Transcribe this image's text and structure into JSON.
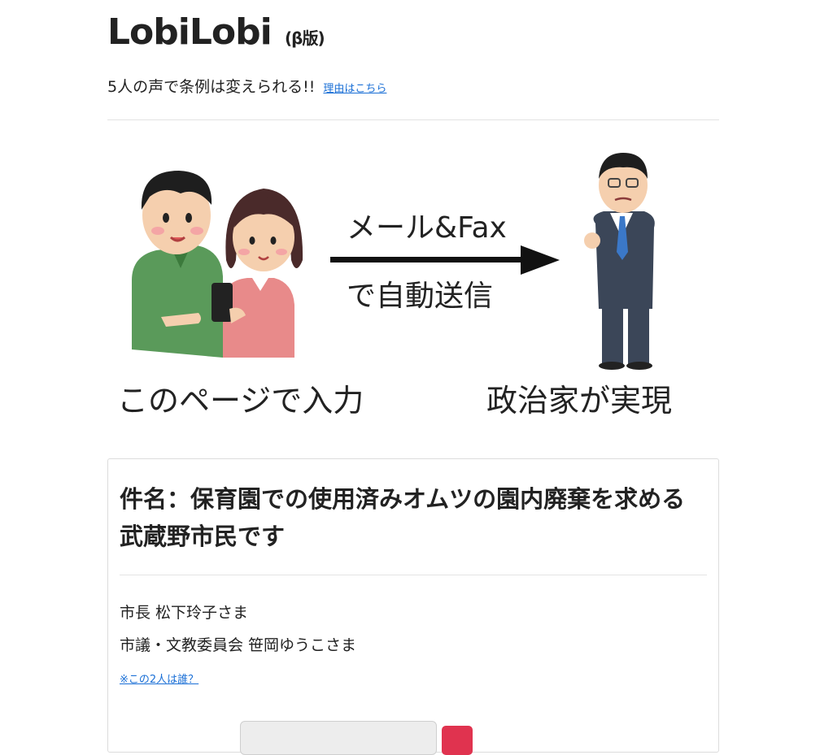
{
  "header": {
    "title": "LobiLobi",
    "beta": "(β版)",
    "tagline": "5人の声で条例は変えられる!!",
    "reason_link": "理由はこちら"
  },
  "hero": {
    "arrow_top": "メール&Fax",
    "arrow_bottom": "で自動送信",
    "left_caption": "このページで入力",
    "right_caption": "政治家が実現"
  },
  "petition": {
    "title": "件名：保育園での使用済みオムツの園内廃棄を求める武蔵野市民です",
    "recipients": [
      "市長 松下玲子さま",
      "市議・文教委員会 笹岡ゆうこさま"
    ],
    "who_link": "※この2人は誰？"
  },
  "colors": {
    "link": "#1a6fd6",
    "accent_button": "#e0334f",
    "man_shirt": "#5a9a5a",
    "woman_shirt": "#e88a8a",
    "suit": "#3b4658"
  }
}
